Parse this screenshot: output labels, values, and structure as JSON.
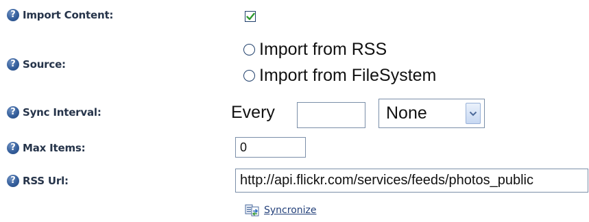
{
  "colors": {
    "label_text": "#26344a",
    "help_icon": "#355f9c",
    "link": "#23407a",
    "check_mark": "#2f9a2f",
    "input_border": "#7a8ea8"
  },
  "icons": {
    "help": "question-circle-icon",
    "check": "check-icon",
    "dropdown": "chevron-down-icon",
    "sync": "sync-icon"
  },
  "fields": {
    "import_content": {
      "label": "Import Content:",
      "checked": true
    },
    "source": {
      "label": "Source:",
      "options": [
        {
          "label": "Import from RSS",
          "selected": false
        },
        {
          "label": "Import from FileSystem",
          "selected": false
        }
      ]
    },
    "sync_interval": {
      "label": "Sync Interval:",
      "prefix": "Every",
      "value": "",
      "unit_selected": "None"
    },
    "max_items": {
      "label": "Max Items:",
      "value": "0"
    },
    "rss_url": {
      "label": "RSS Url:",
      "value": "http://api.flickr.com/services/feeds/photos_public"
    }
  },
  "actions": {
    "syncronize_label": "Syncronize"
  }
}
